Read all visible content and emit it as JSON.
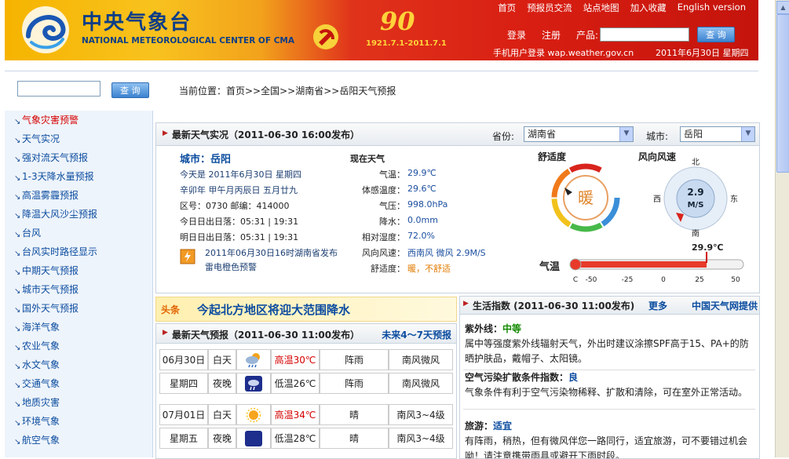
{
  "header": {
    "logo_cn": "中央气象台",
    "logo_en": "NATIONAL METEOROLOGICAL CENTER OF CMA",
    "anniversary_num": "90",
    "anniversary_dates": "1921.7.1-2011.7.1",
    "nav": [
      "首页",
      "预报员交流",
      "站点地图",
      "加入收藏",
      "English version"
    ],
    "login": "登录",
    "register": "注册",
    "product_label": "产品:",
    "query_btn": "查 询",
    "mobile": "手机用户登录 wap.weather.gov.cn",
    "date": "2011年6月30日 星期四"
  },
  "search": {
    "button": "查 询"
  },
  "breadcrumb": "当前位置：首页>>全国>>湖南省>>岳阳天气预报",
  "sidebar": {
    "items": [
      {
        "label": "气象灾害预警",
        "active": true
      },
      {
        "label": "天气实况"
      },
      {
        "label": "强对流天气预报"
      },
      {
        "label": "1-3天降水量预报"
      },
      {
        "label": "高温雾霾预报"
      },
      {
        "label": "降温大风沙尘预报"
      },
      {
        "label": "台风"
      },
      {
        "label": "台风实时路径显示"
      },
      {
        "label": "中期天气预报"
      },
      {
        "label": "城市天气预报"
      },
      {
        "label": "国外天气预报"
      },
      {
        "label": "海洋气象"
      },
      {
        "label": "农业气象"
      },
      {
        "label": "水文气象"
      },
      {
        "label": "交通气象"
      },
      {
        "label": "地质灾害"
      },
      {
        "label": "环境气象"
      },
      {
        "label": "航空气象"
      }
    ]
  },
  "live": {
    "title": "最新天气实况（2011-06-30 16:00发布）",
    "province_label": "省份:",
    "province_value": "湖南省",
    "city_label": "城市:",
    "city_value": "岳阳",
    "city_line": "城市：岳阳",
    "today": "今天是 2011年6月30日 星期四",
    "lunar": "辛卯年 甲午月丙辰日 五月廿九",
    "codes": "区号：0730  邮编：414000",
    "today_sun": "今日日出日落：05:31 | 19:31",
    "tomorrow_sun": "明日日出日落：05:31 | 19:31",
    "warning_text": "2011年06月30日16时湖南省发布雷电橙色预警",
    "now_title": "现在天气",
    "fields": [
      {
        "label": "气温：",
        "value": "29.9℃"
      },
      {
        "label": "体感温度：",
        "value": "29.6℃"
      },
      {
        "label": "气压：",
        "value": "998.0hPa"
      },
      {
        "label": "降水：",
        "value": "0.0mm"
      },
      {
        "label": "相对湿度：",
        "value": "72.0%"
      },
      {
        "label": "风向风速：",
        "value": "西南风 微风 2.9M/S"
      },
      {
        "label": "舒适度：",
        "value": "暖，不舒适"
      }
    ],
    "comfort_title": "舒适度",
    "comfort_value": "暖",
    "wind_title": "风向风速",
    "wind_speed": "2.9",
    "wind_unit": "M/S",
    "compass": {
      "n": "北",
      "s": "南",
      "e": "东",
      "w": "西"
    },
    "temp_label": "气温",
    "temp_value": "29.9℃",
    "temp_reading": 29.9,
    "temp_scale": [
      "C",
      "-50",
      "-25",
      "0",
      "25",
      "50"
    ]
  },
  "headline": {
    "badge": "头条",
    "text": "今起北方地区将迎大范围降水"
  },
  "forecast": {
    "title": "最新天气预报（2011-06-30 11:00发布）",
    "more": "未来4～7天预报",
    "days": [
      {
        "date": "06月30日",
        "weekday": "星期四",
        "day": {
          "period": "白天",
          "icon": "cloudy-rain-icon",
          "temp": "高温30℃",
          "weather": "阵雨",
          "wind": "南风微风"
        },
        "night": {
          "period": "夜晚",
          "icon": "night-rain-icon",
          "temp": "低温26℃",
          "weather": "阵雨",
          "wind": "南风微风"
        }
      },
      {
        "date": "07月01日",
        "weekday": "星期五",
        "day": {
          "period": "白天",
          "icon": "sun-icon",
          "temp": "高温34℃",
          "weather": "晴",
          "wind": "南风3~4级"
        },
        "night": {
          "period": "夜晚",
          "icon": "moon-icon",
          "temp": "低温28℃",
          "weather": "晴",
          "wind": "南风3~4级"
        }
      }
    ]
  },
  "life": {
    "title": "生活指数 (2011-06-30 11:00发布)",
    "more": "更多",
    "provider": "中国天气网提供",
    "items": [
      {
        "title": "紫外线：",
        "level": "中等",
        "desc": "属中等强度紫外线辐射天气，外出时建议涂擦SPF高于15、PA+的防晒护肤品，戴帽子、太阳镜。"
      },
      {
        "title": "空气污染扩散条件指数：",
        "level": "良",
        "desc": "气象条件有利于空气污染物稀释、扩散和清除，可在室外正常活动。"
      },
      {
        "title": "旅游：",
        "level": "适宜",
        "desc": "有阵雨，稍热，但有微风伴您一路同行，适宜旅游，可不要错过机会呦！请注意携带雨具或避开下雨时段。"
      }
    ]
  },
  "colors": {
    "brand_blue": "#0d3e86",
    "link_blue": "#0c4da0",
    "alert_red": "#d50000",
    "header_red": "#d81e12"
  }
}
